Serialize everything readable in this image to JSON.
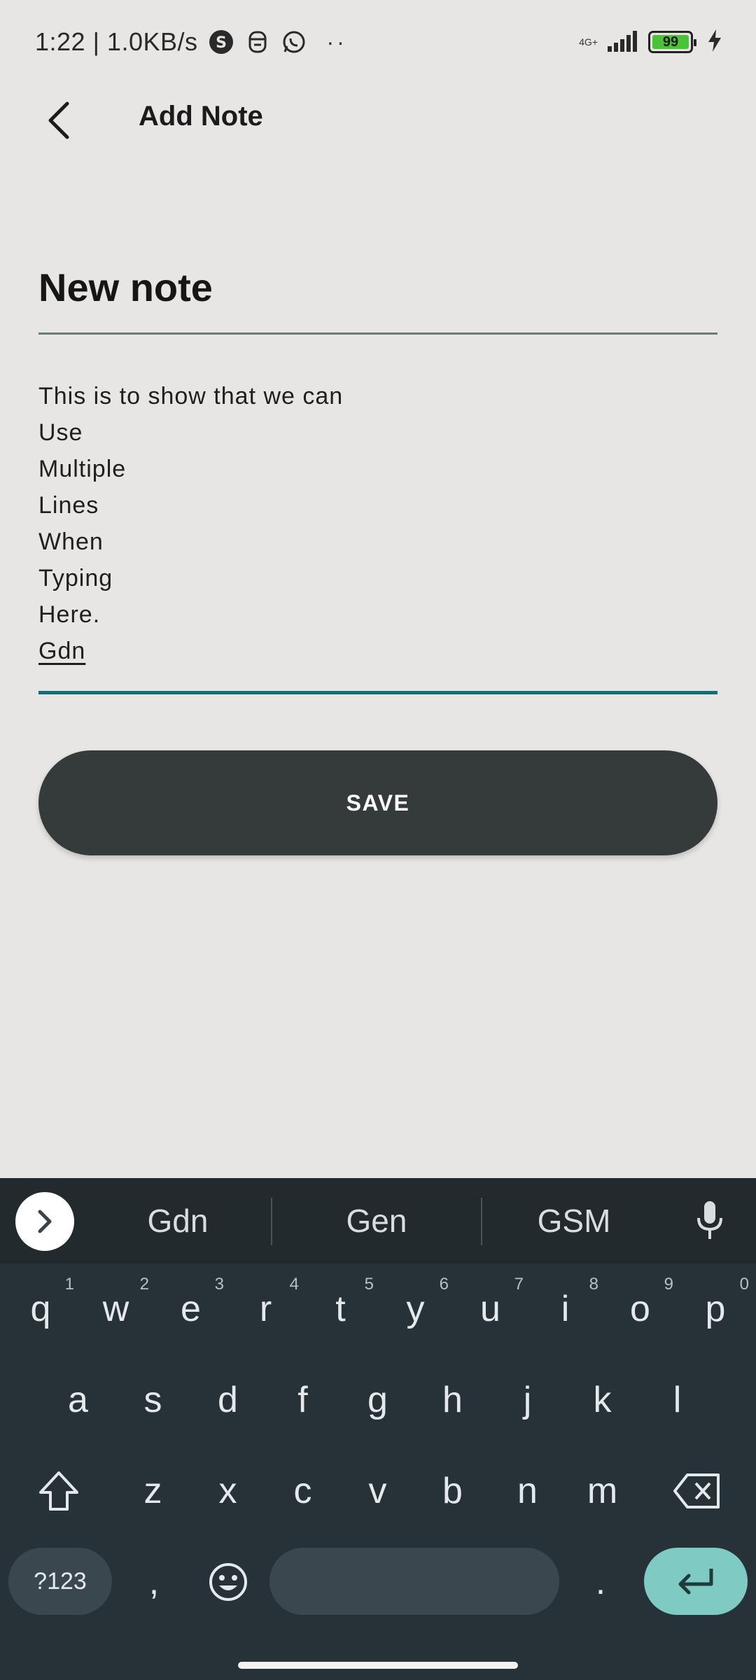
{
  "status_bar": {
    "time_speed": "1:22 | 1.0KB/s",
    "more": "··",
    "network_label_top": "4G+",
    "battery_level": "99"
  },
  "app_bar": {
    "title": "Add Note"
  },
  "note": {
    "title_value": "New note",
    "body_lines": [
      "This is to show that we can",
      "Use",
      "Multiple",
      "Lines",
      "When",
      "Typing",
      "Here.",
      "Gdn"
    ]
  },
  "save_button": {
    "label": "SAVE"
  },
  "keyboard": {
    "suggestions": [
      "Gdn",
      "Gen",
      "GSM"
    ],
    "row1": [
      {
        "k": "q",
        "h": "1"
      },
      {
        "k": "w",
        "h": "2"
      },
      {
        "k": "e",
        "h": "3"
      },
      {
        "k": "r",
        "h": "4"
      },
      {
        "k": "t",
        "h": "5"
      },
      {
        "k": "y",
        "h": "6"
      },
      {
        "k": "u",
        "h": "7"
      },
      {
        "k": "i",
        "h": "8"
      },
      {
        "k": "o",
        "h": "9"
      },
      {
        "k": "p",
        "h": "0"
      }
    ],
    "row2": [
      "a",
      "s",
      "d",
      "f",
      "g",
      "h",
      "j",
      "k",
      "l"
    ],
    "row3": [
      "z",
      "x",
      "c",
      "v",
      "b",
      "n",
      "m"
    ],
    "symbols_label": "?123",
    "comma": ",",
    "period": "."
  }
}
